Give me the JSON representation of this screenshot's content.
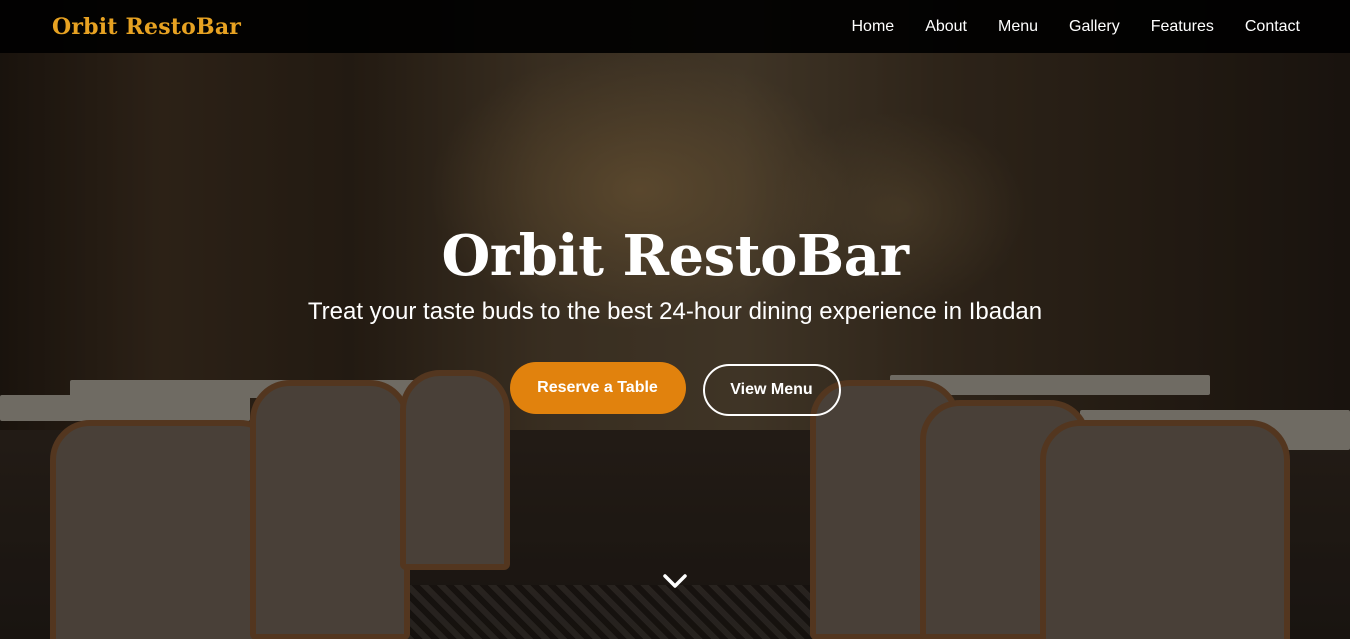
{
  "brand": {
    "name": "Orbit RestoBar"
  },
  "nav": {
    "items": [
      {
        "label": "Home"
      },
      {
        "label": "About"
      },
      {
        "label": "Menu"
      },
      {
        "label": "Gallery"
      },
      {
        "label": "Features"
      },
      {
        "label": "Contact"
      }
    ]
  },
  "hero": {
    "title": "Orbit RestoBar",
    "subtitle": "Treat your taste buds to the best 24-hour dining experience in Ibadan",
    "primary_button": "Reserve a Table",
    "secondary_button": "View Menu",
    "scroll_icon": "chevron-down-icon"
  },
  "colors": {
    "accent": "#e1820d",
    "logo": "#e7a222",
    "navbar_bg": "#000000"
  }
}
